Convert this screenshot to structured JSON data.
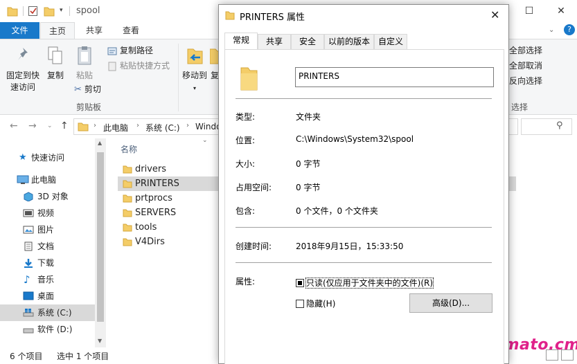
{
  "explorer": {
    "title": "spool",
    "tabs": {
      "file": "文件",
      "home": "主页",
      "share": "共享",
      "view": "查看"
    },
    "ribbon": {
      "pin_label": "固定到快速访问",
      "copy_label": "复制",
      "paste_label": "粘贴",
      "copy_path_label": "复制路径",
      "paste_shortcut_label": "粘贴快捷方式",
      "cut_label": "剪切",
      "clipboard_group": "剪贴板",
      "move_to_label": "移动到",
      "copy_to_partial": "复",
      "select_all_label": "全部选择",
      "select_none_label": "全部取消",
      "invert_selection_label": "反向选择",
      "select_group": "选择"
    },
    "address": {
      "crumbs": [
        "此电脑",
        "系统 (C:)",
        "Windo"
      ]
    },
    "nav": {
      "items": [
        "快速访问",
        "此电脑",
        "3D 对象",
        "视频",
        "图片",
        "文档",
        "下载",
        "音乐",
        "桌面",
        "系统 (C:)",
        "软件 (D:)"
      ]
    },
    "content": {
      "column_name": "名称",
      "files": [
        "drivers",
        "PRINTERS",
        "prtprocs",
        "SERVERS",
        "tools",
        "V4Dirs"
      ]
    },
    "status": {
      "item_count": "6 个项目",
      "selected": "选中 1 个项目"
    }
  },
  "dialog": {
    "title": "PRINTERS 属性",
    "tabs": [
      "常规",
      "共享",
      "安全",
      "以前的版本",
      "自定义"
    ],
    "name_value": "PRINTERS",
    "rows": [
      {
        "label": "类型:",
        "value": "文件夹"
      },
      {
        "label": "位置:",
        "value": "C:\\Windows\\System32\\spool"
      },
      {
        "label": "大小:",
        "value": "0 字节"
      },
      {
        "label": "占用空间:",
        "value": "0 字节"
      },
      {
        "label": "包含:",
        "value": "0 个文件，0 个文件夹"
      }
    ],
    "created_label": "创建时间:",
    "created_value": "2018年9月15日，15:33:50",
    "attributes_label": "属性:",
    "readonly_label": "只读(仅应用于文件夹中的文件)(R)",
    "hidden_label": "隐藏(H)",
    "advanced_label": "高级(D)..."
  },
  "watermark": "tomato.cm",
  "colors": {
    "accent": "#1979ca",
    "folder": "#f4cd68",
    "selection": "#d9d9d9",
    "watermark": "#e0218a"
  }
}
